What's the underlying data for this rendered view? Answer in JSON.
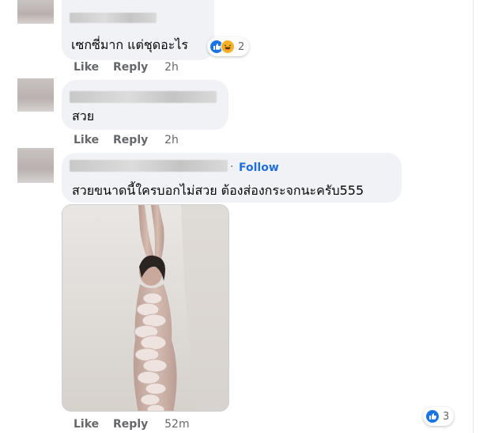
{
  "comments": [
    {
      "text": "เซกซี่มาก แต่ชุดอะไร",
      "like_label": "Like",
      "reply_label": "Reply",
      "time": "2h",
      "reaction_count": "2",
      "reactions": [
        "like-icon",
        "haha-icon"
      ]
    },
    {
      "text": "สวย",
      "like_label": "Like",
      "reply_label": "Reply",
      "time": "2h"
    },
    {
      "follow_label": "Follow",
      "separator": "·",
      "text": "สวยขนาดนี้ใครบอกไม่สวย ต้องส่องกระจกนะครับ555",
      "like_label": "Like",
      "reply_label": "Reply",
      "time": "52m",
      "reaction_count": "3",
      "reactions": [
        "like-icon"
      ],
      "photo_icon": "photo-of-woman-in-sheer-dress-with-ruffles"
    }
  ],
  "colors": {
    "bubble": "#f0f2f5",
    "meta_text": "#65676b",
    "follow_link": "#216fdb",
    "like_blue": "#1b74e4",
    "haha_yellow": "#f7b125"
  }
}
